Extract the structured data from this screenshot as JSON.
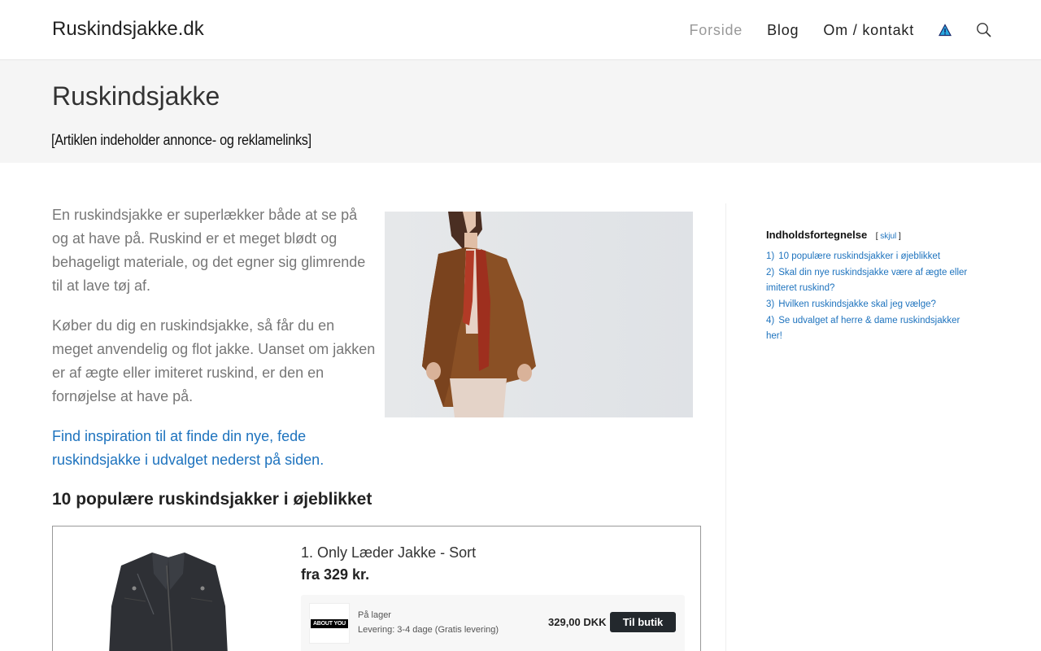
{
  "header": {
    "logo": "Ruskindsjakke.dk",
    "nav": [
      "Forside",
      "Blog",
      "Om / kontakt"
    ],
    "active_nav": "Forside"
  },
  "title_band": {
    "title": "Ruskindsjakke",
    "disclosure": "[Artiklen indeholder annonce- og reklamelinks]"
  },
  "article": {
    "paragraphs": [
      "En ruskindsjakke er superlækker både at se på og at have på. Ruskind er et meget blødt og behageligt materiale, og det egner sig glimrende til at lave tøj af.",
      "Køber du dig en ruskindsjakke, så får du en meget anvendelig og flot jakke. Uanset om jakken er af ægte eller imiteret ruskind, er den en fornøjelse at have på."
    ],
    "link_text": "Find inspiration til at finde din nye, fede ruskindsjakke i udvalget nederst på siden.",
    "section_heading": "10 populære ruskindsjakker i øjeblikket"
  },
  "product": {
    "name": "1. Only Læder Jakke - Sort",
    "from_price": "fra 329 kr.",
    "shop_logo_text": "ABOUT YOU",
    "stock": "På lager",
    "delivery": "Levering: 3-4 dage (Gratis levering)",
    "price": "329,00 DKK",
    "button": "Til butik"
  },
  "toc": {
    "title": "Indholdsfortegnelse",
    "toggle_open": "[",
    "toggle": "skjul",
    "toggle_close": "]",
    "items": [
      {
        "num": "1)",
        "label": "10 populære ruskindsjakker i øjeblikket"
      },
      {
        "num": "2)",
        "label": "Skal din nye ruskindsjakke være af ægte eller imiteret ruskind?"
      },
      {
        "num": "3)",
        "label": "Hvilken ruskindsjakke skal jeg vælge?"
      },
      {
        "num": "4)",
        "label": "Se udvalget af herre & dame ruskindsjakker her!"
      }
    ]
  },
  "colors": {
    "link": "#1e73be",
    "button_bg": "#23282d",
    "band_bg": "#f5f5f5"
  }
}
